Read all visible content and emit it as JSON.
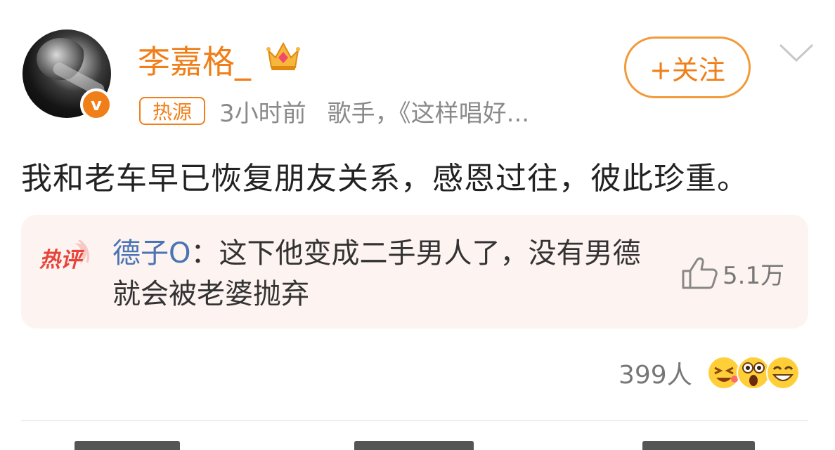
{
  "post": {
    "username": "李嘉格_",
    "hot_badge": "热源",
    "time": "3小时前",
    "description": "歌手，《这样唱好...",
    "follow_label": "+关注",
    "content": "我和老车早已恢复朋友关系，感恩过往，彼此珍重。"
  },
  "hot_comment": {
    "label": "热评",
    "author": "德子O",
    "separator": "：",
    "text": "这下他变成二手男人了，没有男德就会被老婆抛弃",
    "likes": "5.1万"
  },
  "reactions": {
    "count": "399人",
    "icons": [
      "laugh-cry-emoji-icon",
      "shocked-emoji-icon",
      "grin-emoji-icon"
    ]
  },
  "colors": {
    "accent": "#f07f19",
    "author_blue": "#4a74b3",
    "comment_bg": "#fdf3f1",
    "meta_gray": "#8a8a8a"
  }
}
